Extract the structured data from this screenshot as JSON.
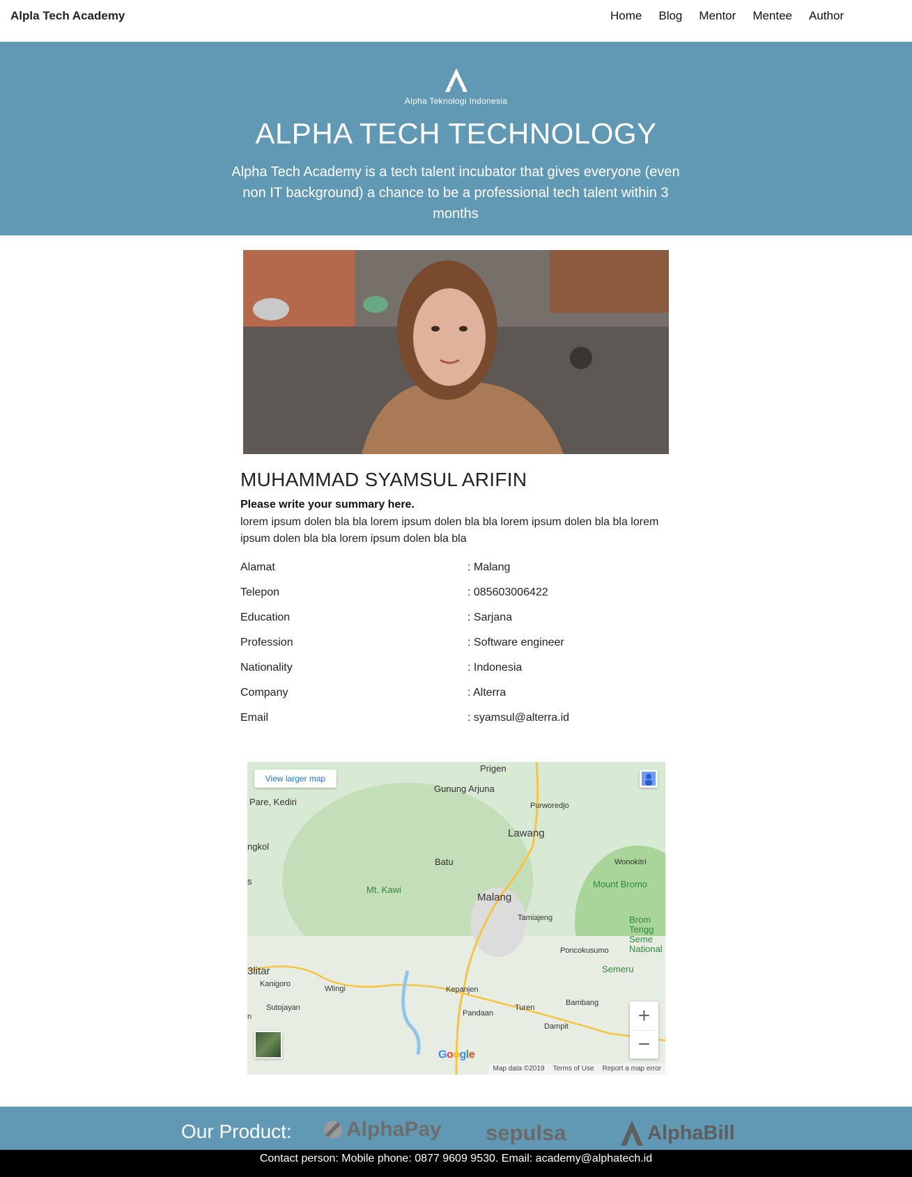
{
  "navbar": {
    "brand": "Alpla Tech Academy",
    "links": [
      "Home",
      "Blog",
      "Mentor",
      "Mentee",
      "Author"
    ]
  },
  "hero": {
    "logo_text": "Alpha Teknologi Indonesia",
    "title": "ALPHA TECH TECHNOLOGY",
    "description": "Alpha Tech Academy is a tech talent incubator that gives everyone (even non IT background) a chance to be a professional tech talent within 3 months"
  },
  "profile": {
    "name": "MUHAMMAD SYAMSUL ARIFIN",
    "summary_title": "Please write your summary here.",
    "summary_text": "lorem ipsum dolen bla bla lorem ipsum dolen bla bla lorem ipsum dolen bla bla lorem ipsum dolen bla bla lorem ipsum dolen bla bla",
    "info": [
      {
        "label": "Alamat",
        "value": ": Malang"
      },
      {
        "label": "Telepon",
        "value": ": 085603006422"
      },
      {
        "label": "Education",
        "value": ": Sarjana"
      },
      {
        "label": "Profession",
        "value": ": Software engineer"
      },
      {
        "label": "Nationality",
        "value": ": Indonesia"
      },
      {
        "label": "Company",
        "value": ": Alterra"
      },
      {
        "label": "Email",
        "value": ": syamsul@alterra.id"
      }
    ]
  },
  "map": {
    "view_larger": "View larger map",
    "labels": [
      "Prigen",
      "Gunung Arjuna",
      "Purworedjo",
      "Pare, Kediri",
      "Lawang",
      "ngkol",
      "Batu",
      "Wonokitri",
      "s",
      "Mt. Kawi",
      "Mount Bromo",
      "Malang",
      "Tamiajeng",
      "Brom Tengg Seme National",
      "Poncokusumo",
      "3litar",
      "Semeru",
      "Kanigoro",
      "Wlingi",
      "Kepanjen",
      "Sutojayan",
      "Bambang",
      "Turen",
      "n",
      "Pandaan",
      "Dampit"
    ],
    "zoom_in": "+",
    "zoom_out": "−",
    "google": "Google",
    "footer": [
      "Map data ©2019",
      "Terms of Use",
      "Report a map error"
    ]
  },
  "footer": {
    "product_label": "Our Product:",
    "products": [
      "AlphaPay",
      "sepulsa",
      "AlphaBill"
    ],
    "contact": "Contact person: Mobile phone: 0877 9609 9530. Email: academy@alphatech.id"
  }
}
